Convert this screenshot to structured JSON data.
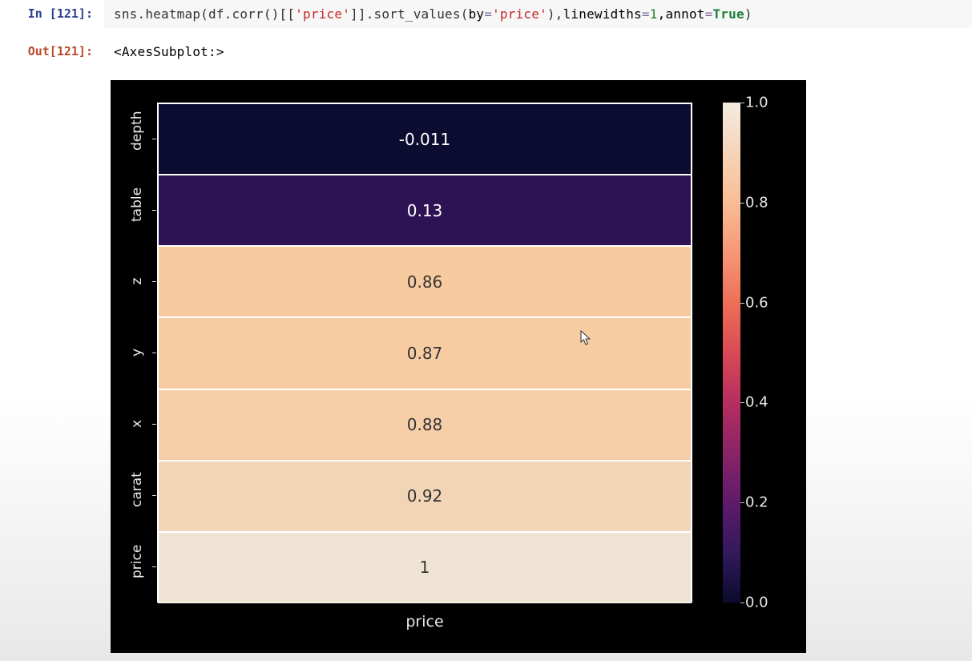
{
  "input": {
    "prompt": "In [121]:",
    "code_tokens": {
      "func1": "sns.heatmap",
      "lp1": "(",
      "func2": "df.corr",
      "lp2": "()[[",
      "str1": "'price'",
      "rb1": "]].",
      "func3": "sort_values",
      "lp3": "(",
      "kw1": "by",
      "eq1": "=",
      "str2": "'price'",
      "rp3": "),",
      "kw2": "linewidths",
      "eq2": "=",
      "num1": "1",
      "com": ",",
      "kw3": "annot",
      "eq3": "=",
      "bool1": "True",
      "rp1": ")"
    }
  },
  "output": {
    "prompt": "Out[121]:",
    "repr": "<AxesSubplot:>"
  },
  "chart_data": {
    "type": "heatmap",
    "xlabel": "price",
    "categories": [
      "depth",
      "table",
      "z",
      "y",
      "x",
      "carat",
      "price"
    ],
    "values": [
      -0.011,
      0.13,
      0.86,
      0.87,
      0.88,
      0.92,
      1
    ],
    "value_labels": [
      "-0.011",
      "0.13",
      "0.86",
      "0.87",
      "0.88",
      "0.92",
      "1"
    ],
    "colorbar_ticks": [
      "1.0",
      "0.8",
      "0.6",
      "0.4",
      "0.2",
      "0.0"
    ],
    "cell_colors": [
      "#0b0c30",
      "#2d1354",
      "#f8ca9f",
      "#f8cca2",
      "#f6cfa9",
      "#f2d5b7",
      "#efe3d4"
    ],
    "text_colors": [
      "#ffffff",
      "#ffffff",
      "#333333",
      "#333333",
      "#333333",
      "#333333",
      "#333333"
    ]
  }
}
